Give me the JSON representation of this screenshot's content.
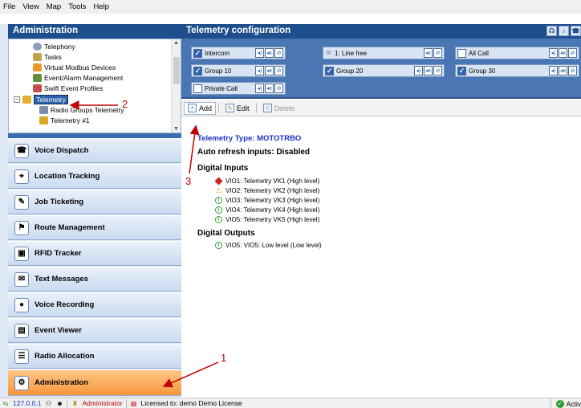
{
  "menu": [
    "File",
    "View",
    "Map",
    "Tools",
    "Help"
  ],
  "left_panel": {
    "title": "Administration",
    "tree": [
      {
        "label": "Telephony",
        "icon": "phone-icon"
      },
      {
        "label": "Tasks",
        "icon": "tasks-icon"
      },
      {
        "label": "Virtual Modbus Devices",
        "icon": "modbus-icon"
      },
      {
        "label": "Event/Alarm Management",
        "icon": "alarm-icon"
      },
      {
        "label": "Swift Event Profiles",
        "icon": "profile-icon"
      },
      {
        "label": "Telemetry",
        "icon": "telemetry-icon"
      },
      {
        "label": "Radio Groups Telemetry",
        "icon": "radio-groups-icon"
      },
      {
        "label": "Telemetry #1",
        "icon": "telemetry-item-icon"
      }
    ],
    "nav": [
      {
        "label": "Voice Dispatch",
        "icon": "voice-dispatch-icon",
        "glyph": "☎"
      },
      {
        "label": "Location Tracking",
        "icon": "location-tracking-icon",
        "glyph": "⌖"
      },
      {
        "label": "Job Ticketing",
        "icon": "job-ticketing-icon",
        "glyph": "✎"
      },
      {
        "label": "Route Management",
        "icon": "route-management-icon",
        "glyph": "⚑"
      },
      {
        "label": "RFID Tracker",
        "icon": "rfid-icon",
        "glyph": "▣"
      },
      {
        "label": "Text Messages",
        "icon": "text-messages-icon",
        "glyph": "✉"
      },
      {
        "label": "Voice Recording",
        "icon": "voice-recording-icon",
        "glyph": "●"
      },
      {
        "label": "Event Viewer",
        "icon": "event-viewer-icon",
        "glyph": "▤"
      },
      {
        "label": "Radio Allocation",
        "icon": "radio-allocation-icon",
        "glyph": "☰"
      },
      {
        "label": "Administration",
        "icon": "administration-icon",
        "glyph": "⚙"
      }
    ]
  },
  "right_panel": {
    "title": "Telemetry configuration",
    "groups": [
      {
        "label": "Intercom",
        "checked": true
      },
      {
        "label": "1: Line free",
        "checked": false,
        "icon": "line-icon"
      },
      {
        "label": "All Call",
        "checked": false
      },
      {
        "label": "Group 10",
        "checked": true
      },
      {
        "label": "Group 20",
        "checked": true
      },
      {
        "label": "Group 30",
        "checked": true
      },
      {
        "label": "Private Call",
        "checked": false
      }
    ],
    "toolbar": {
      "add": "Add",
      "edit": "Edit",
      "delete": "Delete"
    },
    "content": {
      "type_line": "Telemetry Type: MOTOTRBO",
      "refresh_line": "Auto refresh inputs: Disabled",
      "inputs_header": "Digital Inputs",
      "inputs": [
        {
          "text": "VIO1: Telemetry VK1 (High level)",
          "status": "error"
        },
        {
          "text": "VIO2: Telemetry VK2 (High level)",
          "status": "warning"
        },
        {
          "text": "VIO3: Telemetry VK3 (High level)",
          "status": "ok"
        },
        {
          "text": "VIO4: Telemetry VK4 (High level)",
          "status": "ok"
        },
        {
          "text": "VIO5: Telemetry VK5 (High level)",
          "status": "ok"
        }
      ],
      "outputs_header": "Digital Outputs",
      "outputs": [
        {
          "text": "VIO5: VIO5: Low level (Low level)",
          "status": "ok"
        }
      ]
    }
  },
  "callouts": [
    "1",
    "2",
    "3"
  ],
  "status": {
    "ip": "127.0.0.1",
    "user": "Administrator",
    "license": "Licensed to: demo Demo License",
    "active": "Activ"
  },
  "colors": {
    "header_blue": "#1f4e8c",
    "group_bar": "#4a76b4",
    "accent_orange": "#f7953e",
    "callout_red": "#c00000"
  }
}
